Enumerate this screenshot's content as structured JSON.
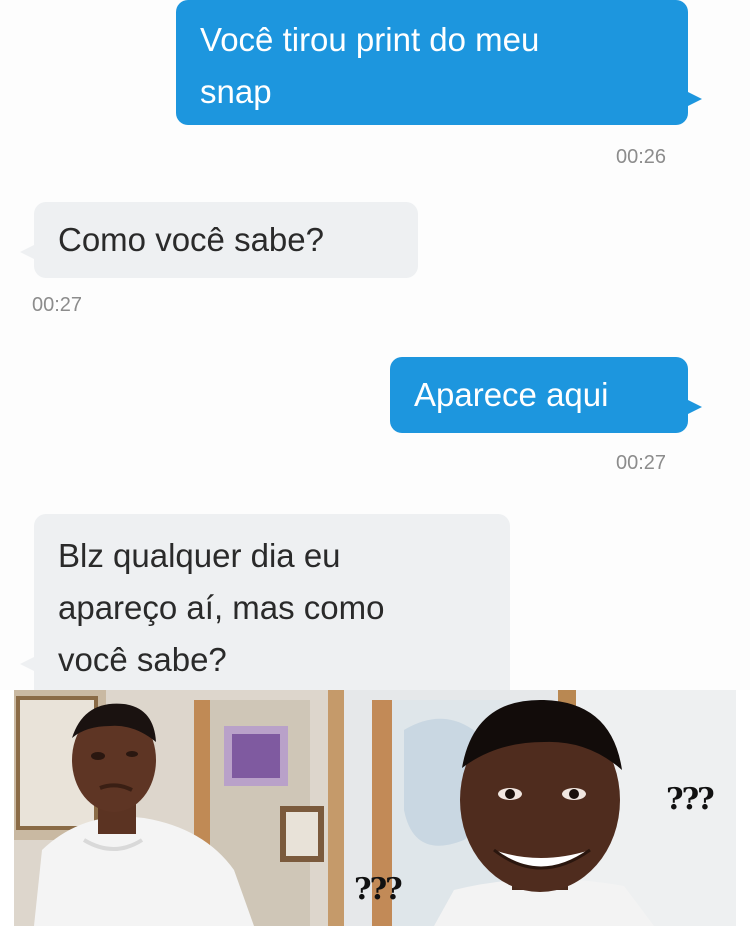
{
  "messages": [
    {
      "text_lines": [
        "Você tirou print do meu",
        "snap"
      ],
      "time": "00:26",
      "side": "outgoing"
    },
    {
      "text_lines": [
        "Como você sabe?"
      ],
      "time": "00:27",
      "side": "incoming"
    },
    {
      "text_lines": [
        "Aparece aqui"
      ],
      "time": "00:27",
      "side": "outgoing"
    },
    {
      "text_lines": [
        "Blz qualquer dia eu",
        "apareço aí, mas como",
        "você sabe?"
      ],
      "side": "incoming"
    }
  ],
  "meme": {
    "left_caption": "???",
    "right_caption": "???"
  },
  "colors": {
    "outgoing_bubble": "#1d96de",
    "incoming_bubble": "#eef0f2",
    "timestamp": "#8c8c8c"
  }
}
